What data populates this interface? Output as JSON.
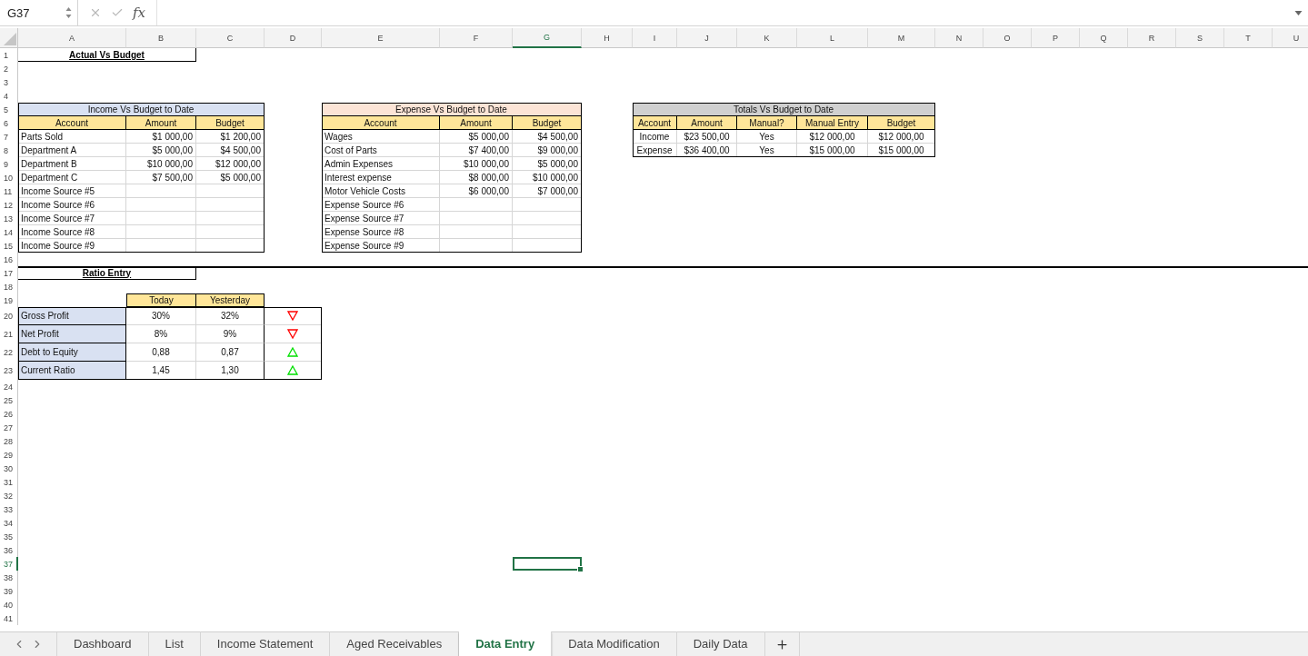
{
  "name_box": "G37",
  "formula_label": "fx",
  "column_headers": [
    {
      "label": "A",
      "selected": false
    },
    {
      "label": "B",
      "selected": false
    },
    {
      "label": "C",
      "selected": false
    },
    {
      "label": "D",
      "selected": false
    },
    {
      "label": "E",
      "selected": false
    },
    {
      "label": "F",
      "selected": false
    },
    {
      "label": "G",
      "selected": true
    },
    {
      "label": "H",
      "selected": false
    },
    {
      "label": "I",
      "selected": false
    },
    {
      "label": "J",
      "selected": false
    },
    {
      "label": "K",
      "selected": false
    },
    {
      "label": "L",
      "selected": false
    },
    {
      "label": "M",
      "selected": false
    },
    {
      "label": "N",
      "selected": false
    },
    {
      "label": "O",
      "selected": false
    },
    {
      "label": "P",
      "selected": false
    },
    {
      "label": "Q",
      "selected": false
    },
    {
      "label": "R",
      "selected": false
    },
    {
      "label": "S",
      "selected": false
    },
    {
      "label": "T",
      "selected": false
    },
    {
      "label": "U",
      "selected": false
    }
  ],
  "row_numbers": [
    {
      "label": "1",
      "selected": false
    },
    {
      "label": "2",
      "selected": false
    },
    {
      "label": "3",
      "selected": false
    },
    {
      "label": "4",
      "selected": false
    },
    {
      "label": "5",
      "selected": false
    },
    {
      "label": "6",
      "selected": false
    },
    {
      "label": "7",
      "selected": false
    },
    {
      "label": "8",
      "selected": false
    },
    {
      "label": "9",
      "selected": false
    },
    {
      "label": "10",
      "selected": false
    },
    {
      "label": "11",
      "selected": false
    },
    {
      "label": "12",
      "selected": false
    },
    {
      "label": "13",
      "selected": false
    },
    {
      "label": "14",
      "selected": false
    },
    {
      "label": "15",
      "selected": false
    },
    {
      "label": "16",
      "selected": false
    },
    {
      "label": "17",
      "selected": false
    },
    {
      "label": "18",
      "selected": false
    },
    {
      "label": "19",
      "selected": false
    },
    {
      "label": "20",
      "selected": false
    },
    {
      "label": "21",
      "selected": false
    },
    {
      "label": "22",
      "selected": false
    },
    {
      "label": "23",
      "selected": false
    },
    {
      "label": "24",
      "selected": false
    },
    {
      "label": "25",
      "selected": false
    },
    {
      "label": "26",
      "selected": false
    },
    {
      "label": "27",
      "selected": false
    },
    {
      "label": "28",
      "selected": false
    },
    {
      "label": "29",
      "selected": false
    },
    {
      "label": "30",
      "selected": false
    },
    {
      "label": "31",
      "selected": false
    },
    {
      "label": "32",
      "selected": false
    },
    {
      "label": "33",
      "selected": false
    },
    {
      "label": "34",
      "selected": false
    },
    {
      "label": "35",
      "selected": false
    },
    {
      "label": "36",
      "selected": false
    },
    {
      "label": "37",
      "selected": true
    },
    {
      "label": "38",
      "selected": false
    },
    {
      "label": "39",
      "selected": false
    },
    {
      "label": "40",
      "selected": false
    },
    {
      "label": "41",
      "selected": false
    }
  ],
  "actual_vs_budget": {
    "title": "Actual Vs Budget"
  },
  "income_table": {
    "title": "Income Vs Budget to Date",
    "columns": [
      "Account",
      "Amount",
      "Budget"
    ],
    "rows": [
      {
        "account": "Parts Sold",
        "amount": "$1 000,00",
        "budget": "$1 200,00"
      },
      {
        "account": "Department A",
        "amount": "$5 000,00",
        "budget": "$4 500,00"
      },
      {
        "account": "Department B",
        "amount": "$10 000,00",
        "budget": "$12 000,00"
      },
      {
        "account": "Department C",
        "amount": "$7 500,00",
        "budget": "$5 000,00"
      },
      {
        "account": "Income Source #5"
      },
      {
        "account": "Income Source #6"
      },
      {
        "account": "Income Source #7"
      },
      {
        "account": "Income Source #8"
      },
      {
        "account": "Income Source #9"
      }
    ]
  },
  "expense_table": {
    "title": "Expense Vs Budget to Date",
    "columns": [
      "Account",
      "Amount",
      "Budget"
    ],
    "rows": [
      {
        "account": "Wages",
        "amount": "$5 000,00",
        "budget": "$4 500,00"
      },
      {
        "account": "Cost of Parts",
        "amount": "$7 400,00",
        "budget": "$9 000,00"
      },
      {
        "account": "Admin Expenses",
        "amount": "$10 000,00",
        "budget": "$5 000,00"
      },
      {
        "account": "Interest expense",
        "amount": "$8 000,00",
        "budget": "$10 000,00"
      },
      {
        "account": "Motor Vehicle Costs",
        "amount": "$6 000,00",
        "budget": "$7 000,00"
      },
      {
        "account": "Expense Source #6"
      },
      {
        "account": "Expense Source #7"
      },
      {
        "account": "Expense Source #8"
      },
      {
        "account": "Expense Source #9"
      }
    ]
  },
  "totals_table": {
    "title": "Totals Vs Budget to Date",
    "columns": [
      "Account",
      "Amount",
      "Manual?",
      "Manual Entry",
      "Budget"
    ],
    "rows": [
      {
        "account": "Income",
        "amount": "$23 500,00",
        "manual": "Yes",
        "manual_entry": "$12 000,00",
        "budget": "$12 000,00"
      },
      {
        "account": "Expense",
        "amount": "$36 400,00",
        "manual": "Yes",
        "manual_entry": "$15 000,00",
        "budget": "$15 000,00"
      }
    ]
  },
  "ratio_entry": {
    "title": "Ratio Entry",
    "columns": [
      "Today",
      "Yesterday"
    ],
    "rows": [
      {
        "label": "Gross Profit",
        "today": "30%",
        "yesterday": "32%",
        "rising": false
      },
      {
        "label": "Net Profit",
        "today": "8%",
        "yesterday": "9%",
        "rising": false
      },
      {
        "label": "Debt to Equity",
        "today": "0,88",
        "yesterday": "0,87",
        "rising": true
      },
      {
        "label": "Current Ratio",
        "today": "1,45",
        "yesterday": "1,30",
        "rising": true
      }
    ]
  },
  "sheet_tabs": [
    {
      "label": "Dashboard",
      "selected": false
    },
    {
      "label": "List",
      "selected": false
    },
    {
      "label": "Income Statement",
      "selected": false
    },
    {
      "label": "Aged Receivables",
      "selected": false
    },
    {
      "label": "Data Entry",
      "selected": true
    },
    {
      "label": "Data Modification",
      "selected": false
    },
    {
      "label": "Daily Data",
      "selected": false
    }
  ]
}
